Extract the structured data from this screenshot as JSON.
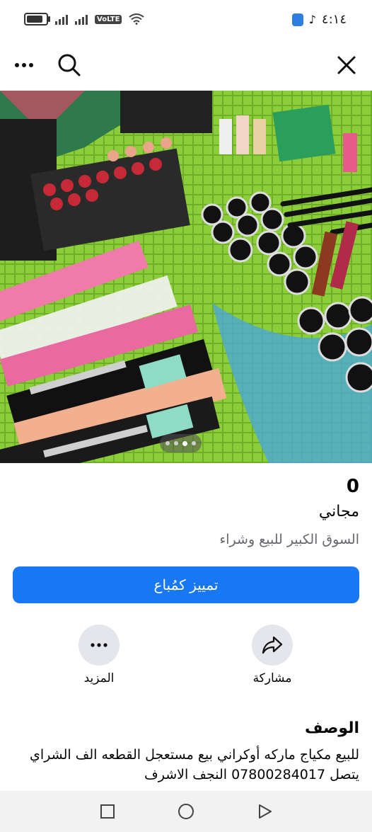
{
  "status_bar": {
    "time": "٤:١٤",
    "network_label": "VoLTE"
  },
  "listing": {
    "price": "0",
    "price_label": "مجاني",
    "seller_group": "السوق الكبير للبيع وشراء",
    "primary_action": "تمييز كمُباع",
    "carousel": {
      "total": 4,
      "active_index": 2
    }
  },
  "actions": {
    "share_label": "مشاركة",
    "more_label": "المزيد"
  },
  "description": {
    "title": "الوصف",
    "text": "للبيع مكياج ماركه أوكراني بيع مستعجل القطعه الف الشراي يتصل 07800284017 النجف الاشرف"
  },
  "icons": [
    "more-icon",
    "search-icon",
    "close-icon",
    "share-icon",
    "more-horizontal-icon",
    "recents-icon",
    "home-icon",
    "back-icon"
  ],
  "colors": {
    "accent": "#1877f2",
    "secondary_button_bg": "#e4e6eb",
    "muted_text": "#65676b"
  }
}
